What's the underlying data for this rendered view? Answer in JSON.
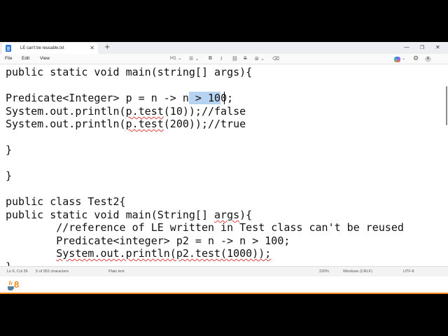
{
  "tab": {
    "title": "LE can't be reusable.txt",
    "close": "✕",
    "new_tab": "+"
  },
  "window_controls": {
    "minimize": "—",
    "maximize": "❐",
    "close": "✕"
  },
  "menu": {
    "file": "File",
    "edit": "Edit",
    "view": "View"
  },
  "toolbar": {
    "heading": "H1 ⌄",
    "list": "☰ ⌄",
    "bold": "B",
    "italic": "I",
    "link": "⛓",
    "strike": "S",
    "table": "⊞ ⌄",
    "clear": "⌫"
  },
  "account": {
    "avatar_initial": "A",
    "copilot_chevron": "⌄",
    "settings": "⚙"
  },
  "code": {
    "l1": "public static void main(string[] args){",
    "l3_pre": "Predicate<Integer> p = n -> n",
    "l3_sel": " > 10",
    "l3_post": "0;",
    "l4_a": "System.out.println(",
    "l4_b": "p.test",
    "l4_c": "(10));//false",
    "l5_a": "System.out.println(",
    "l5_b": "p.test",
    "l5_c": "(200));//true",
    "l7": "}",
    "l9": "}",
    "l11": "public class Test2{",
    "l12_a": "public static void main(String[] ",
    "l12_b": "args",
    "l12_c": "){",
    "l13": "        //reference of LE written in Test class can't be reused",
    "l14": "        Predicate<integer> p2 = n -> n > 100;",
    "l15_indent": "        ",
    "l15_a": "System.out.println(p2.test(1000));",
    "l16": "}"
  },
  "status": {
    "position": "Ln 6, Col 36",
    "chars": "5 of 952 characters",
    "format": "Plain text",
    "zoom": "220%",
    "eol": "Windows (CRLF)",
    "encoding": "UTF-8"
  },
  "branding": {
    "java_version": "8"
  },
  "colors": {
    "selection": "#b6d3f1",
    "java_orange": "#f08a1c",
    "squiggle": "#e04040"
  }
}
